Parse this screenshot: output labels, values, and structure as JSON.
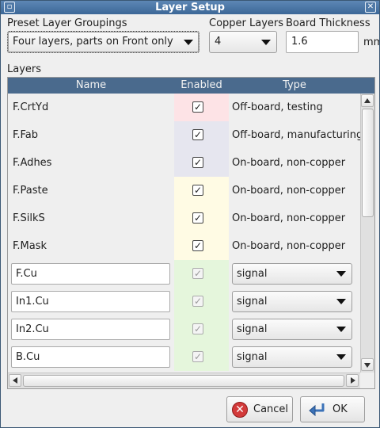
{
  "window": {
    "title": "Layer Setup",
    "title_buttons": [
      "restore-icon",
      "close-icon"
    ]
  },
  "preset": {
    "label": "Preset Layer Groupings",
    "value": "Four layers, parts on Front only"
  },
  "copper": {
    "label": "Copper Layers",
    "value": "4"
  },
  "thickness": {
    "label": "Board Thickness",
    "value": "1.6",
    "unit": "mm"
  },
  "layers": {
    "section_label": "Layers",
    "columns": [
      "Name",
      "Enabled",
      "Type"
    ],
    "rows": [
      {
        "name": "F.CrtYd",
        "enabled": true,
        "enabled_disabled": false,
        "type": "Off-board, testing",
        "editable": false,
        "enabled_bg": "#fde3e6"
      },
      {
        "name": "F.Fab",
        "enabled": true,
        "enabled_disabled": false,
        "type": "Off-board, manufacturing",
        "editable": false,
        "enabled_bg": "#e6e6ef"
      },
      {
        "name": "F.Adhes",
        "enabled": true,
        "enabled_disabled": false,
        "type": "On-board, non-copper",
        "editable": false,
        "enabled_bg": "#e6e6ef"
      },
      {
        "name": "F.Paste",
        "enabled": true,
        "enabled_disabled": false,
        "type": "On-board, non-copper",
        "editable": false,
        "enabled_bg": "#fffbe4"
      },
      {
        "name": "F.SilkS",
        "enabled": true,
        "enabled_disabled": false,
        "type": "On-board, non-copper",
        "editable": false,
        "enabled_bg": "#fffbe4"
      },
      {
        "name": "F.Mask",
        "enabled": true,
        "enabled_disabled": false,
        "type": "On-board, non-copper",
        "editable": false,
        "enabled_bg": "#fffbe4"
      },
      {
        "name": "F.Cu",
        "enabled": true,
        "enabled_disabled": true,
        "type": "signal",
        "editable": true,
        "enabled_bg": "#e5f6dc"
      },
      {
        "name": "In1.Cu",
        "enabled": true,
        "enabled_disabled": true,
        "type": "signal",
        "editable": true,
        "enabled_bg": "#e5f6dc"
      },
      {
        "name": "In2.Cu",
        "enabled": true,
        "enabled_disabled": true,
        "type": "signal",
        "editable": true,
        "enabled_bg": "#e5f6dc"
      },
      {
        "name": "B.Cu",
        "enabled": true,
        "enabled_disabled": true,
        "type": "signal",
        "editable": true,
        "enabled_bg": "#e5f6dc"
      }
    ]
  },
  "buttons": {
    "cancel": "Cancel",
    "ok": "OK"
  },
  "colors": {
    "titlebar": "#4a75a5",
    "header": "#4a6a8d",
    "cancel_icon": "#d23a3a",
    "ok_icon": "#3b72b8"
  }
}
